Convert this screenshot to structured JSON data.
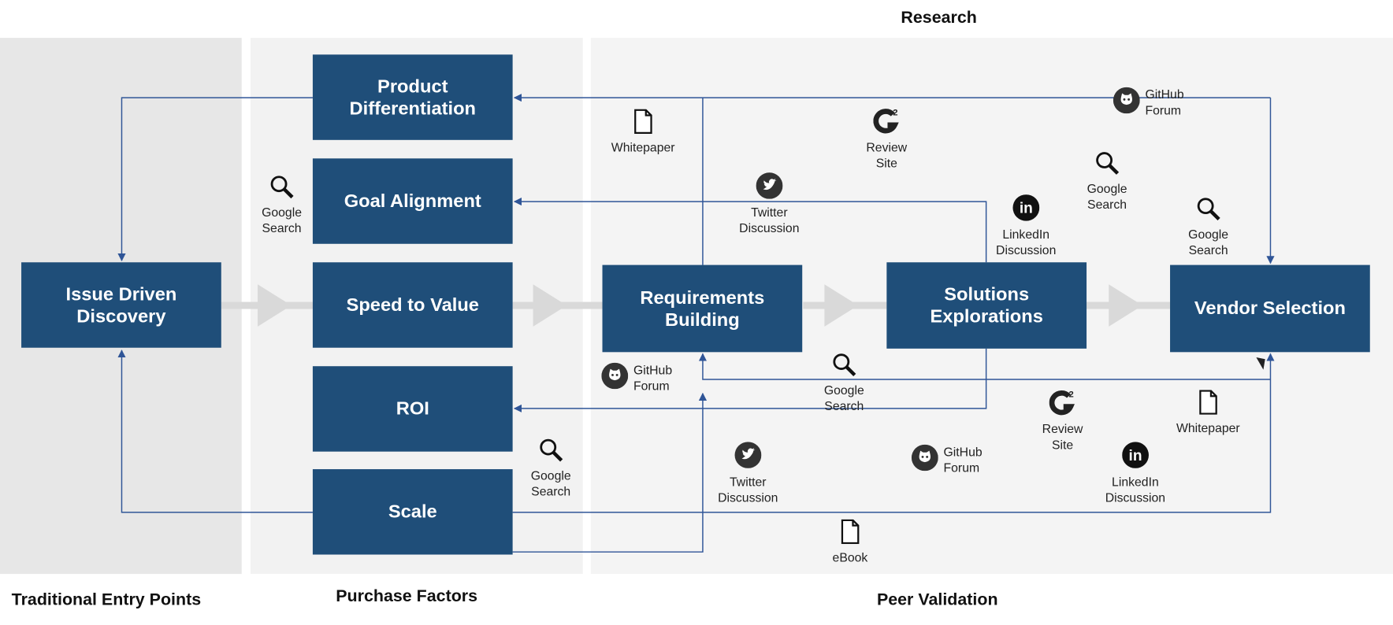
{
  "headers": {
    "research": "Research",
    "traditional": "Traditional Entry Points",
    "purchase": "Purchase Factors",
    "peer": "Peer Validation"
  },
  "colors": {
    "box": "#1f4e79",
    "line": "#2f5597",
    "chevron": "#d9d9d9",
    "panel_left": "#e7e7e7",
    "panel_mid": "#f2f2f2",
    "panel_right": "#f4f4f4"
  },
  "boxes": {
    "issue": "Issue Driven Discovery",
    "product": "Product Differentiation",
    "goal": "Goal Alignment",
    "speed": "Speed to Value",
    "roi": "ROI",
    "scale": "Scale",
    "requirements": "Requirements Building",
    "solutions": "Solutions Explorations",
    "vendor": "Vendor Selection"
  },
  "sources": [
    {
      "icon": "document-icon",
      "label": [
        "Whitepaper"
      ]
    },
    {
      "icon": "g2-icon",
      "label": [
        "Review",
        "Site"
      ]
    },
    {
      "icon": "github-icon",
      "label": [
        "GitHub",
        "Forum"
      ]
    },
    {
      "icon": "search-icon",
      "label": [
        "Google",
        "Search"
      ]
    },
    {
      "icon": "twitter-icon",
      "label": [
        "Twitter",
        "Discussion"
      ]
    },
    {
      "icon": "search-icon",
      "label": [
        "Google",
        "Search"
      ]
    },
    {
      "icon": "linkedin-icon",
      "label": [
        "LinkedIn",
        "Discussion"
      ]
    },
    {
      "icon": "search-icon",
      "label": [
        "Google",
        "Search"
      ]
    },
    {
      "icon": "github-icon",
      "label": [
        "GitHub",
        "Forum"
      ]
    },
    {
      "icon": "search-icon",
      "label": [
        "Google",
        "Search"
      ]
    },
    {
      "icon": "g2-icon",
      "label": [
        "Review",
        "Site"
      ]
    },
    {
      "icon": "document-icon",
      "label": [
        "Whitepaper"
      ]
    },
    {
      "icon": "search-icon",
      "label": [
        "Google",
        "Search"
      ]
    },
    {
      "icon": "twitter-icon",
      "label": [
        "Twitter",
        "Discussion"
      ]
    },
    {
      "icon": "github-icon",
      "label": [
        "GitHub",
        "Forum"
      ]
    },
    {
      "icon": "linkedin-icon",
      "label": [
        "LinkedIn",
        "Discussion"
      ]
    },
    {
      "icon": "document-icon",
      "label": [
        "eBook"
      ]
    }
  ]
}
